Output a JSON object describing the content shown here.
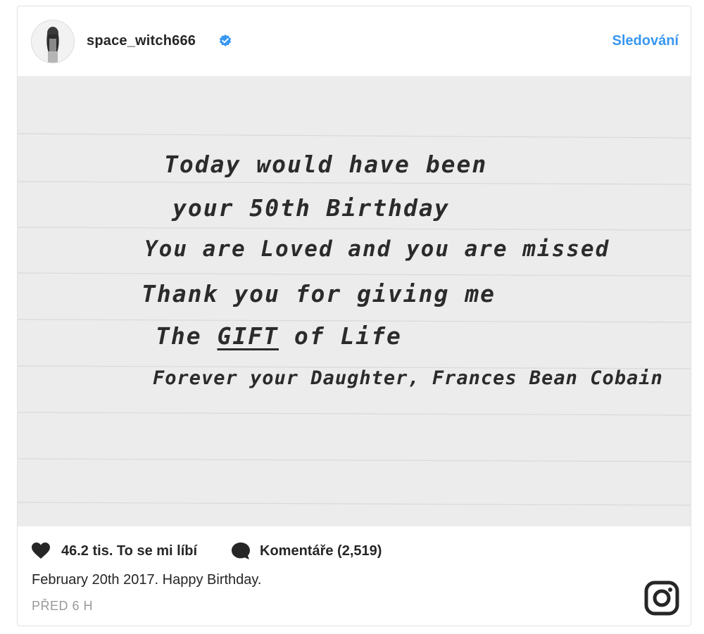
{
  "post": {
    "username": "space_witch666",
    "verified": true,
    "follow_label": "Sledování",
    "photo_text": [
      "Today would have been",
      "your 50th Birthday",
      "You are Loved and you are missed",
      "Thank you for giving me",
      "The GIFT of Life",
      "Forever your Daughter, Frances Bean Cobain"
    ],
    "gift_word": "GIFT",
    "likes_label": "46.2 tis. To se mi líbí",
    "comments_label": "Komentáře (2,519)",
    "caption": "February 20th 2017. Happy Birthday.",
    "timestamp": "PŘED 6 H"
  },
  "icons": {
    "verified": "verified-badge-icon",
    "like": "heart-icon",
    "comment": "comment-bubble-icon",
    "brand": "instagram-logo-icon"
  },
  "colors": {
    "accent": "#3897f0",
    "text": "#262626",
    "muted": "#999999",
    "photo_bg": "#ececec"
  }
}
